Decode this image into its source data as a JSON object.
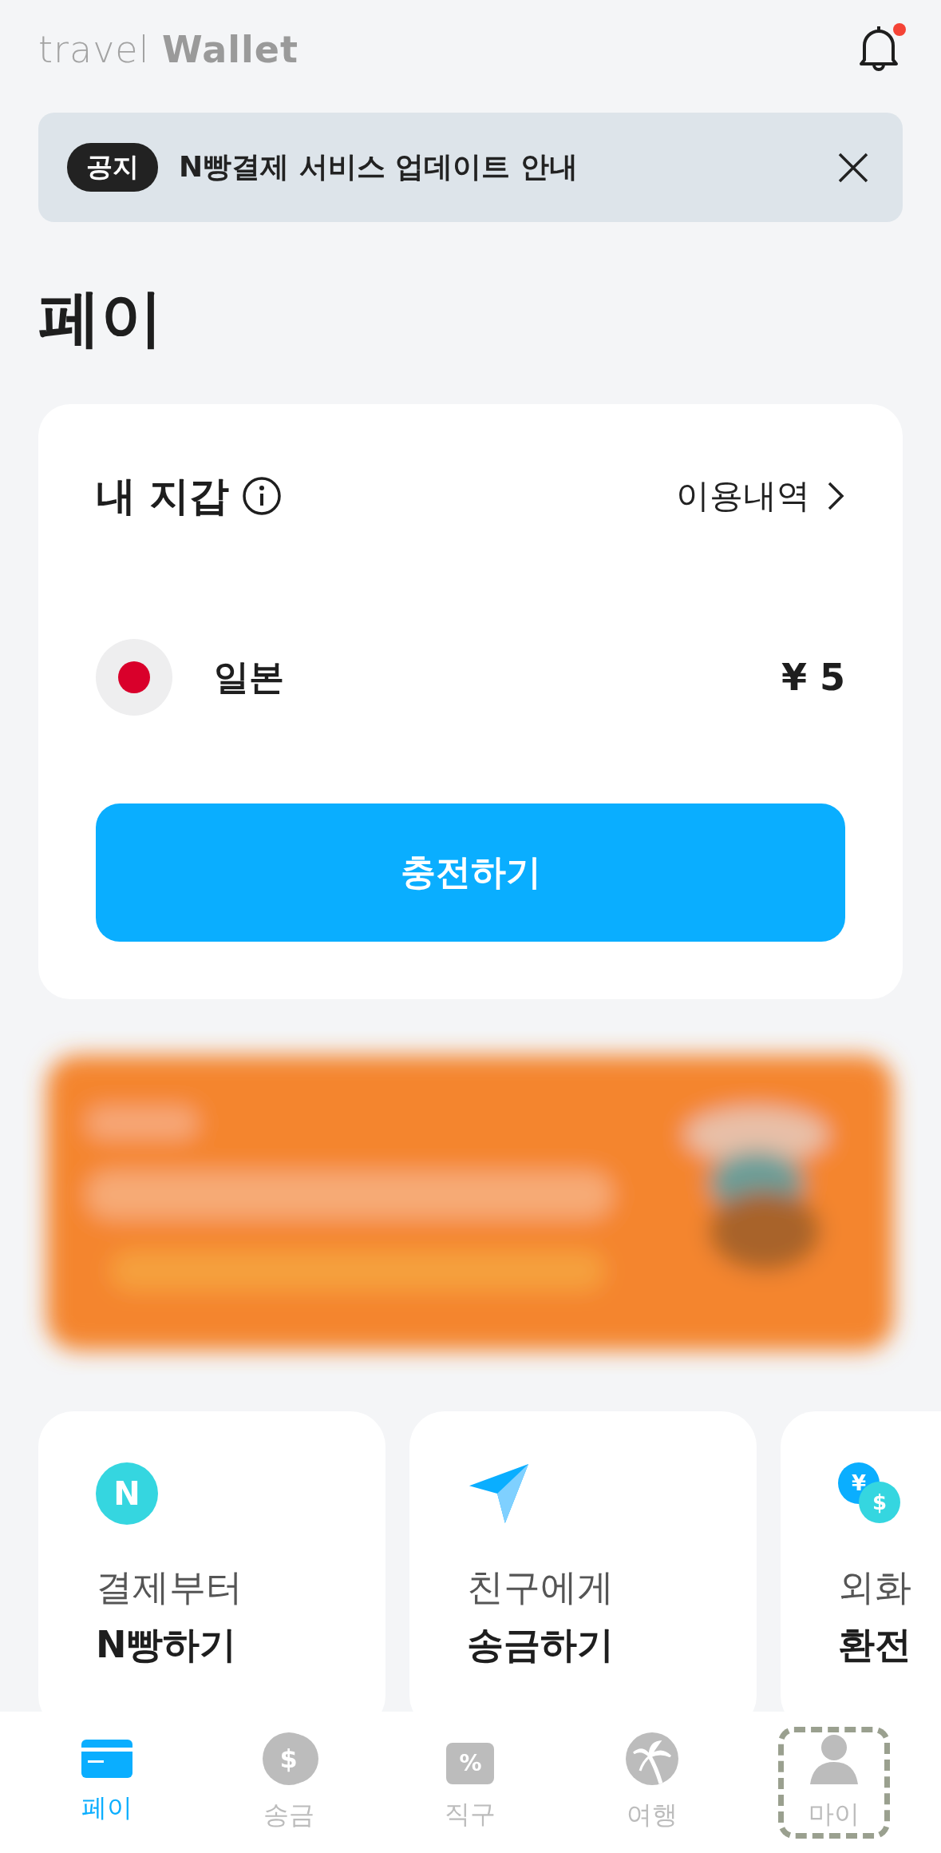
{
  "header": {
    "logo_light": "travel",
    "logo_bold": "Wallet",
    "has_new_notification": true
  },
  "notice": {
    "badge": "공지",
    "text": "N빵결제 서비스 업데이트 안내"
  },
  "page_title": "페이",
  "wallet": {
    "title": "내 지갑",
    "history_link": "이용내역",
    "balances": [
      {
        "country": "일본",
        "amount": "¥ 5"
      }
    ],
    "charge_button": "충전하기"
  },
  "services": [
    {
      "icon_text": [
        "N"
      ],
      "line1": "결제부터",
      "line2": "N빵하기"
    },
    {
      "line1": "친구에게",
      "line2": "송금하기"
    },
    {
      "icon_text": [
        "¥",
        "$"
      ],
      "line1": "외화",
      "line2": "환전"
    }
  ],
  "tabs": [
    {
      "label": "페이",
      "selected": true,
      "highlighted": false
    },
    {
      "label": "송금",
      "icon_text": "$",
      "selected": false,
      "highlighted": false
    },
    {
      "label": "직구",
      "icon_text": "%",
      "selected": false,
      "highlighted": false
    },
    {
      "label": "여행",
      "selected": false,
      "highlighted": false
    },
    {
      "label": "마이",
      "selected": false,
      "highlighted": true
    }
  ]
}
